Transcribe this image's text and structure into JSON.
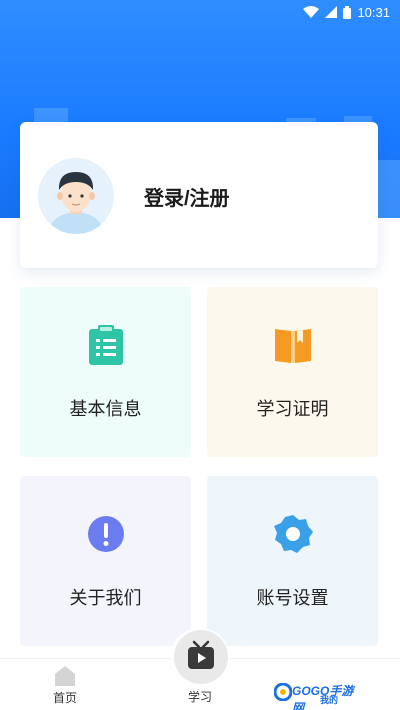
{
  "status_bar": {
    "time": "10:31"
  },
  "profile": {
    "login_label": "登录/注册"
  },
  "menu": {
    "basic_info": "基本信息",
    "study_certificate": "学习证明",
    "about_us": "关于我们",
    "account_settings": "账号设置"
  },
  "bottom_nav": {
    "home": "首页",
    "study": "学习"
  },
  "watermark": {
    "text": "GOGO手游网",
    "sub": "我的"
  },
  "colors": {
    "header_blue": "#1a7bff",
    "basic_icon": "#2ec4a6",
    "cert_icon": "#f59a23",
    "about_icon": "#6b7cf0",
    "settings_icon": "#3aa0e8"
  },
  "icons": {
    "basic_info": "clipboard-icon",
    "study_certificate": "book-icon",
    "about_us": "exclamation-icon",
    "account_settings": "gear-icon",
    "home": "house-icon",
    "study": "tv-play-icon"
  }
}
